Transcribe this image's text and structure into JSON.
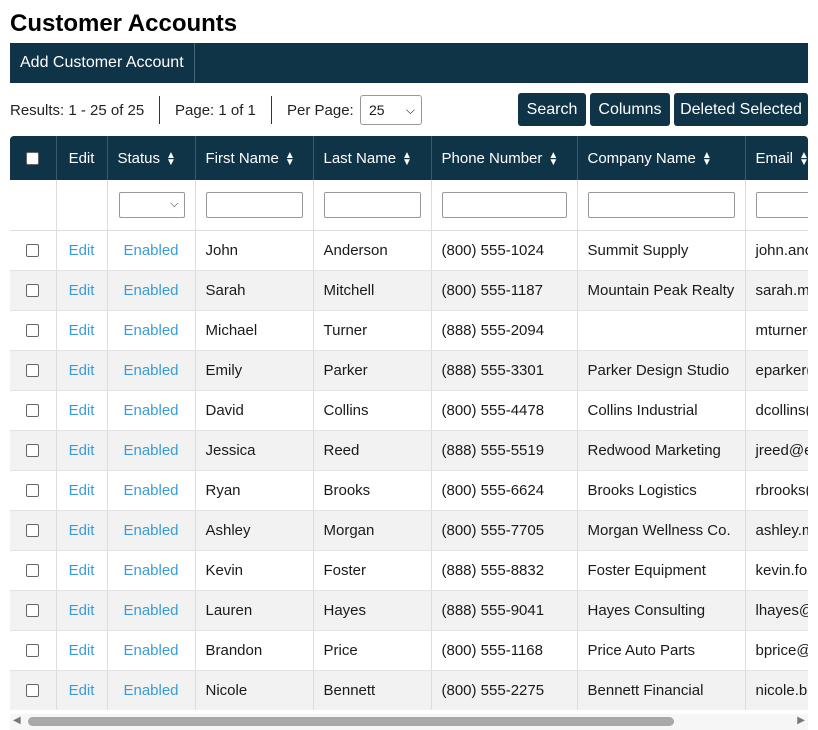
{
  "page": {
    "title": "Customer Accounts"
  },
  "topbar": {
    "add_label": "Add Customer Account"
  },
  "toolbar": {
    "results": "Results: 1 - 25 of 25",
    "page": "Page: 1 of 1",
    "per_page_label": "Per Page:",
    "per_page_value": "25",
    "search_label": "Search",
    "columns_label": "Columns",
    "delete_label": "Deleted Selected"
  },
  "table": {
    "headers": {
      "edit": "Edit",
      "status": "Status",
      "first_name": "First Name",
      "last_name": "Last Name",
      "phone": "Phone Number",
      "company": "Company Name",
      "email": "Email"
    },
    "rows": [
      {
        "edit": "Edit",
        "status": "Enabled",
        "first": "John",
        "last": "Anderson",
        "phone": "(800) 555-1024",
        "company": "Summit Supply",
        "email": "john.anc"
      },
      {
        "edit": "Edit",
        "status": "Enabled",
        "first": "Sarah",
        "last": "Mitchell",
        "phone": "(800) 555-1187",
        "company": "Mountain Peak Realty",
        "email": "sarah.m"
      },
      {
        "edit": "Edit",
        "status": "Enabled",
        "first": "Michael",
        "last": "Turner",
        "phone": "(888) 555-2094",
        "company": "",
        "email": "mturnerc"
      },
      {
        "edit": "Edit",
        "status": "Enabled",
        "first": "Emily",
        "last": "Parker",
        "phone": "(888) 555-3301",
        "company": "Parker Design Studio",
        "email": "eparker("
      },
      {
        "edit": "Edit",
        "status": "Enabled",
        "first": "David",
        "last": "Collins",
        "phone": "(800) 555-4478",
        "company": "Collins Industrial",
        "email": "dcollins("
      },
      {
        "edit": "Edit",
        "status": "Enabled",
        "first": "Jessica",
        "last": "Reed",
        "phone": "(888) 555-5519",
        "company": "Redwood Marketing",
        "email": "jreed@e"
      },
      {
        "edit": "Edit",
        "status": "Enabled",
        "first": "Ryan",
        "last": "Brooks",
        "phone": "(800) 555-6624",
        "company": "Brooks Logistics",
        "email": "rbrooks("
      },
      {
        "edit": "Edit",
        "status": "Enabled",
        "first": "Ashley",
        "last": "Morgan",
        "phone": "(800) 555-7705",
        "company": "Morgan Wellness Co.",
        "email": "ashley.m"
      },
      {
        "edit": "Edit",
        "status": "Enabled",
        "first": "Kevin",
        "last": "Foster",
        "phone": "(888) 555-8832",
        "company": "Foster Equipment",
        "email": "kevin.fos"
      },
      {
        "edit": "Edit",
        "status": "Enabled",
        "first": "Lauren",
        "last": "Hayes",
        "phone": "(888) 555-9041",
        "company": "Hayes Consulting",
        "email": "lhayes@"
      },
      {
        "edit": "Edit",
        "status": "Enabled",
        "first": "Brandon",
        "last": "Price",
        "phone": "(800) 555-1168",
        "company": "Price Auto Parts",
        "email": "bprice@"
      },
      {
        "edit": "Edit",
        "status": "Enabled",
        "first": "Nicole",
        "last": "Bennett",
        "phone": "(800) 555-2275",
        "company": "Bennett Financial",
        "email": "nicole.be"
      }
    ]
  },
  "colors": {
    "header_bg": "#0f3347",
    "link": "#3a9bd9",
    "row_alt": "#f2f2f2"
  },
  "icons": {
    "sort": "sort-updown-icon",
    "dropdown": "chevron-down-icon"
  }
}
